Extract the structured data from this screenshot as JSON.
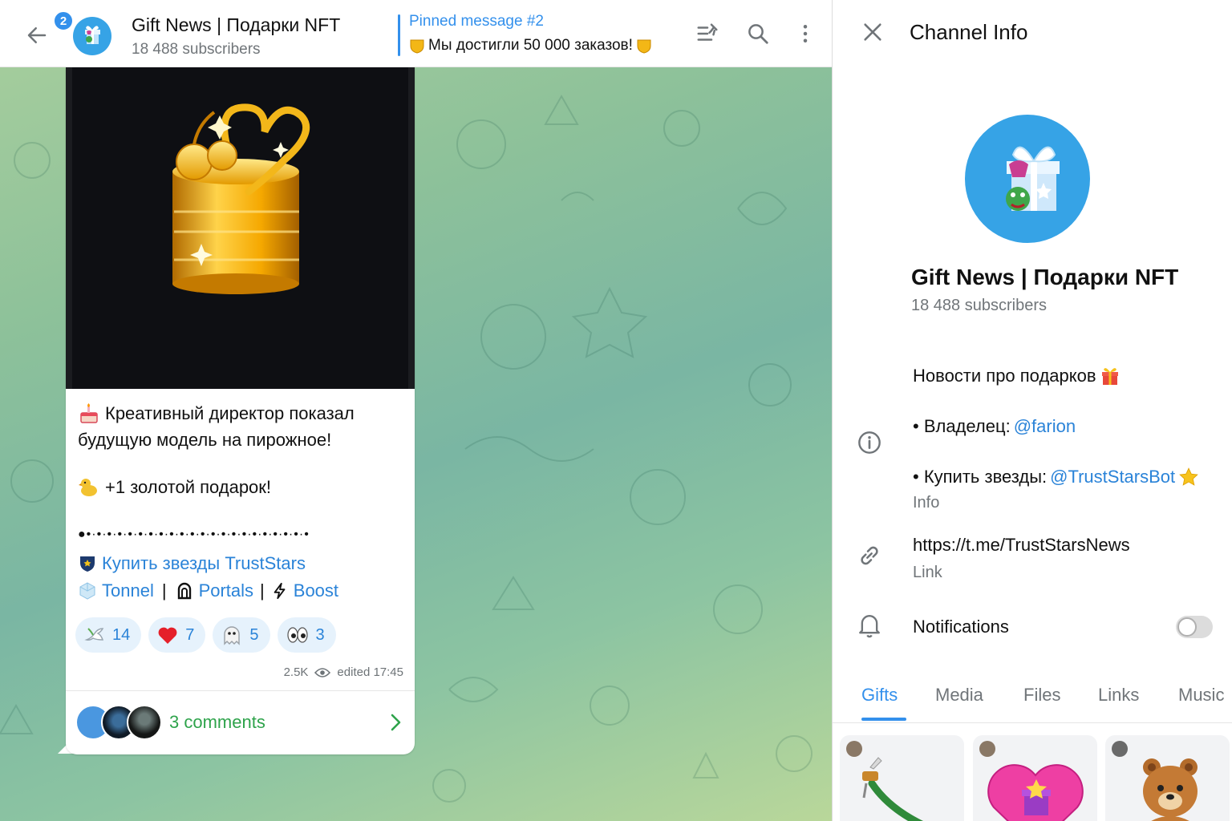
{
  "chat": {
    "unread_count": "2",
    "channel_title": "Gift News | Подарки NFT",
    "subscribers": "18 488 subscribers",
    "pinned_label": "Pinned message #2",
    "pinned_text": "Мы достигли 50 000 заказов!"
  },
  "message": {
    "line1": "Креативный директор показал",
    "line2": "будущую модель на пирожное!",
    "line3": "+1 золотой подарок!",
    "dots": "●•·•·•·•·•·•·•·•·•·•·•·•·•·•·•·•·•·•·•·•·•·•",
    "link_buy": "Купить звезды TrustStars",
    "link_tonnel": "Tonnel",
    "separator": "|",
    "link_portals": "Portals",
    "link_boost": "Boost",
    "reactions": [
      {
        "icon": "dove-icon",
        "count": "14"
      },
      {
        "icon": "heart-icon",
        "count": "7"
      },
      {
        "icon": "ghost-icon",
        "count": "5"
      },
      {
        "icon": "eyes-icon",
        "count": "3"
      }
    ],
    "views": "2.5K",
    "edited": "edited 17:45",
    "comments": "3 comments"
  },
  "panel": {
    "title": "Channel Info",
    "name": "Gift News | Подарки NFT",
    "subscribers": "18 488 subscribers",
    "description": "Новости про подарков",
    "owner_prefix": "• Владелец:",
    "owner_handle": "@farion",
    "buy_prefix": "• Купить звезды:",
    "buy_handle": "@TrustStarsBot",
    "info_caption": "Info",
    "link_url": "https://t.me/TrustStarsNews",
    "link_caption": "Link",
    "notifications": "Notifications",
    "tabs": [
      "Gifts",
      "Media",
      "Files",
      "Links",
      "Music"
    ]
  },
  "colors": {
    "accent": "#3390ec",
    "link": "#2a83d8",
    "comments_green": "#2ea34b"
  }
}
